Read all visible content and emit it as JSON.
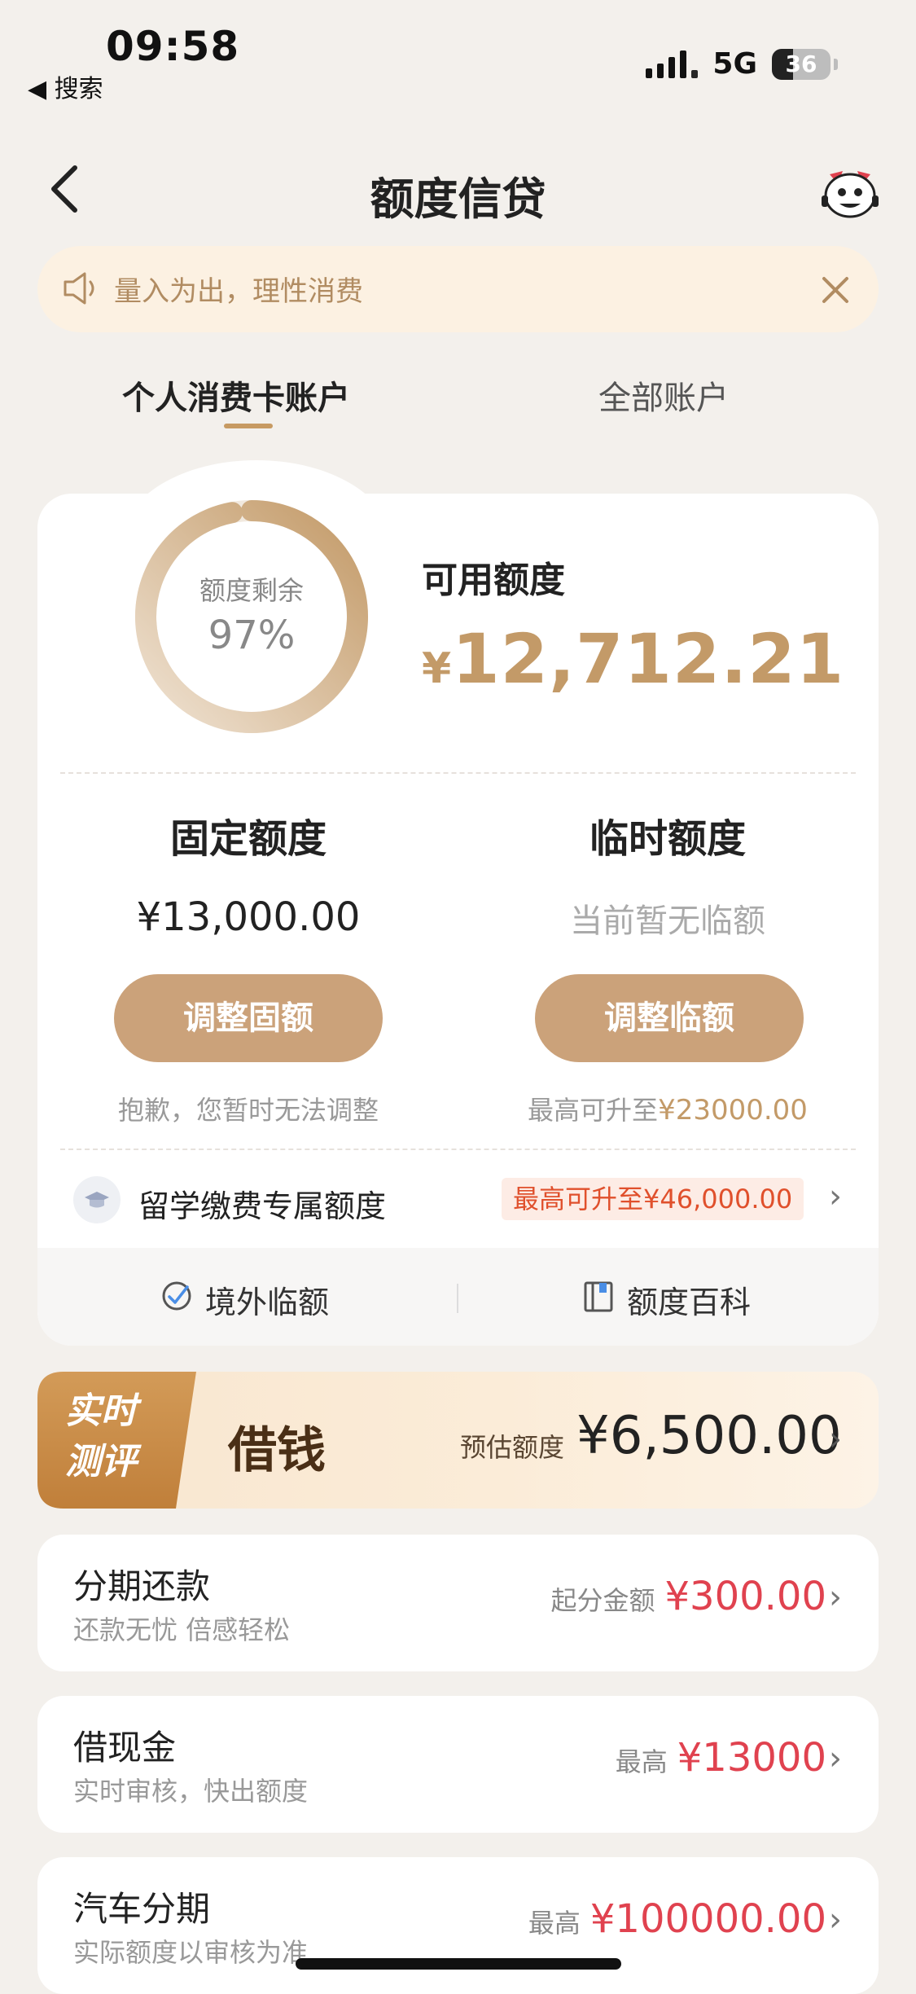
{
  "status_bar": {
    "time": "09:58",
    "back_label": "◀ 搜索",
    "network": "5G",
    "battery": "36"
  },
  "nav": {
    "title": "额度信贷"
  },
  "notice": {
    "text": "量入为出，理性消费"
  },
  "tabs": [
    {
      "label": "个人消费卡账户",
      "active": true
    },
    {
      "label": "全部账户",
      "active": false
    }
  ],
  "credit": {
    "remaining_label": "额度剩余",
    "remaining_percent": "97%",
    "remaining_fraction": 0.97,
    "available_label": "可用额度",
    "available_currency": "¥",
    "available_amount": "12,712.21"
  },
  "fixed": {
    "title": "固定额度",
    "amount": "¥13,000.00",
    "button": "调整固额",
    "note": "抱歉，您暂时无法调整"
  },
  "temporary": {
    "title": "临时额度",
    "status": "当前暂无临额",
    "button": "调整临额",
    "note_prefix": "最高可升至",
    "note_amount": "¥23000.00"
  },
  "study_abroad": {
    "label": "留学缴费专属额度",
    "badge": "最高可升至¥46,000.00"
  },
  "shortcuts": [
    {
      "label": "境外临额"
    },
    {
      "label": "额度百科"
    }
  ],
  "borrow": {
    "tag_line1": "实时",
    "tag_line2": "测评",
    "title": "借钱",
    "estimate_label": "预估额度",
    "estimate_value": "¥6,500.00"
  },
  "items": [
    {
      "title": "分期还款",
      "subtitle": "还款无忧 倍感轻松",
      "right_label": "起分金额",
      "right_value": "¥300.00"
    },
    {
      "title": "借现金",
      "subtitle": "实时审核，快出额度",
      "right_label": "最高",
      "right_value": "¥13000"
    },
    {
      "title": "汽车分期",
      "subtitle": "实际额度以审核为准",
      "right_label": "最高",
      "right_value": "¥100000.00"
    }
  ],
  "colors": {
    "accent_gold": "#c39a68",
    "button_gold": "#cba27a",
    "red_value": "#e0424f",
    "badge_orange": "#e0502c"
  }
}
